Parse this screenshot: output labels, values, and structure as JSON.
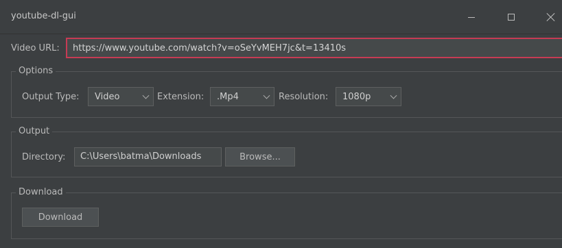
{
  "window": {
    "title": "youtube-dl-gui",
    "minimize_icon": "minimize-icon",
    "maximize_icon": "maximize-icon",
    "close_icon": "close-icon"
  },
  "url": {
    "label": "Video URL:",
    "value": "https://www.youtube.com/watch?v=oSeYvMEH7jc&t=13410s"
  },
  "options": {
    "legend": "Options",
    "output_type_label": "Output Type:",
    "output_type_value": "Video",
    "extension_label": "Extension:",
    "extension_value": ".Mp4",
    "resolution_label": "Resolution:",
    "resolution_value": "1080p"
  },
  "output": {
    "legend": "Output",
    "directory_label": "Directory:",
    "directory_value": "C:\\Users\\batma\\Downloads",
    "browse_label": "Browse..."
  },
  "download": {
    "legend": "Download",
    "button_label": "Download"
  },
  "colors": {
    "background": "#3c3f41",
    "url_border": "#c73b54"
  }
}
